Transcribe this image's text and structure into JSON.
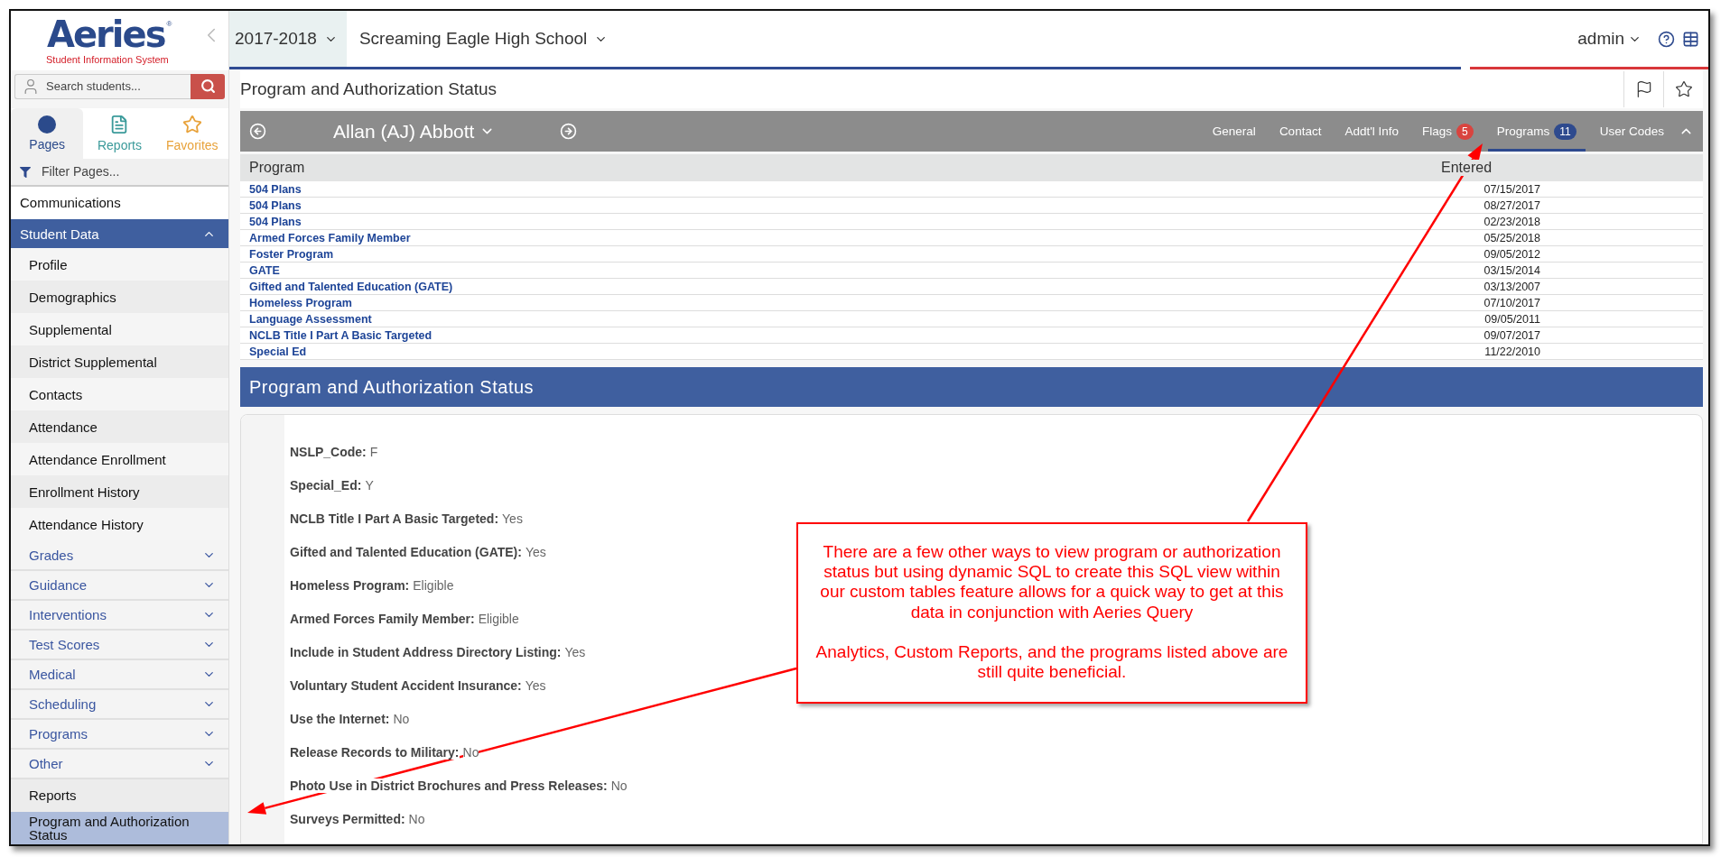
{
  "logo": {
    "name": "Aeries",
    "mark": "®",
    "tagline": "Student Information System"
  },
  "search": {
    "placeholder": "Search students..."
  },
  "sidebar_tabs": [
    {
      "label": "Pages",
      "kind": "pages",
      "color": "#2b4a8b",
      "selected": true
    },
    {
      "label": "Reports",
      "kind": "reports",
      "color": "#3a9a9a",
      "selected": false
    },
    {
      "label": "Favorites",
      "kind": "favorites",
      "color": "#e8a23a",
      "selected": false
    }
  ],
  "filter": {
    "placeholder": "Filter Pages..."
  },
  "nav": [
    {
      "label": "Communications",
      "kind": "page",
      "selected": false
    },
    {
      "label": "Student Data",
      "kind": "group",
      "expanded": true,
      "children": [
        {
          "label": "Profile",
          "kind": "page",
          "selected": false
        },
        {
          "label": "Demographics",
          "kind": "page",
          "selected": false
        },
        {
          "label": "Supplemental",
          "kind": "page",
          "selected": false
        },
        {
          "label": "District Supplemental",
          "kind": "page",
          "selected": false
        },
        {
          "label": "Contacts",
          "kind": "page",
          "selected": false
        },
        {
          "label": "Attendance",
          "kind": "page",
          "selected": false
        },
        {
          "label": "Attendance Enrollment",
          "kind": "page",
          "selected": false
        },
        {
          "label": "Enrollment History",
          "kind": "page",
          "selected": false
        },
        {
          "label": "Attendance History",
          "kind": "page",
          "selected": false
        },
        {
          "label": "Grades",
          "kind": "group",
          "expanded": false
        },
        {
          "label": "Guidance",
          "kind": "group",
          "expanded": false
        },
        {
          "label": "Interventions",
          "kind": "group",
          "expanded": false
        },
        {
          "label": "Test Scores",
          "kind": "group",
          "expanded": false
        },
        {
          "label": "Medical",
          "kind": "group",
          "expanded": false
        },
        {
          "label": "Scheduling",
          "kind": "group",
          "expanded": false
        },
        {
          "label": "Programs",
          "kind": "group",
          "expanded": false
        },
        {
          "label": "Other",
          "kind": "group",
          "expanded": false
        },
        {
          "label": "Reports",
          "kind": "page",
          "selected": false
        },
        {
          "label": "Program and Authorization Status",
          "kind": "page",
          "selected": true
        }
      ]
    }
  ],
  "top_bar": {
    "year": "2017-2018",
    "school": "Screaming Eagle High School",
    "user": "admin"
  },
  "page_title": "Program and Authorization Status",
  "student": {
    "name": "Allan (AJ) Abbott",
    "tabs_expanded": true,
    "tabs": [
      {
        "label": "General",
        "selected": false
      },
      {
        "label": "Contact",
        "selected": false
      },
      {
        "label": "Addt'l Info",
        "selected": false
      },
      {
        "label": "Flags",
        "badge": "5",
        "color": "#d9443f",
        "selected": false
      },
      {
        "label": "Programs",
        "badge": "11",
        "color": "#2e4a8e",
        "selected": true
      },
      {
        "label": "User Codes",
        "selected": false
      }
    ]
  },
  "table": {
    "columns": [
      "Program",
      "Entered"
    ],
    "rows": [
      [
        "504 Plans",
        "07/15/2017"
      ],
      [
        "504 Plans",
        "08/27/2017"
      ],
      [
        "504 Plans",
        "02/23/2018"
      ],
      [
        "Armed Forces Family Member",
        "05/25/2018"
      ],
      [
        "Foster Program",
        "09/05/2012"
      ],
      [
        "GATE",
        "03/15/2014"
      ],
      [
        "Gifted and Talented Education (GATE)",
        "03/13/2007"
      ],
      [
        "Homeless Program",
        "07/10/2017"
      ],
      [
        "Language Assessment",
        "09/05/2011"
      ],
      [
        "NCLB Title I Part A Basic Targeted",
        "09/07/2017"
      ],
      [
        "Special Ed",
        "11/22/2010"
      ]
    ]
  },
  "section": {
    "title": "Program and Authorization Status",
    "fields": [
      {
        "label": "NSLP_Code:",
        "value": "F"
      },
      {
        "label": "Special_Ed:",
        "value": "Y"
      },
      {
        "label": "NCLB Title I Part A Basic Targeted:",
        "value": "Yes"
      },
      {
        "label": "Gifted and Talented Education (GATE):",
        "value": "Yes"
      },
      {
        "label": "Homeless Program:",
        "value": "Eligible"
      },
      {
        "label": "Armed Forces Family Member:",
        "value": "Eligible"
      },
      {
        "label": "Include in Student Address Directory Listing:",
        "value": "Yes"
      },
      {
        "label": "Voluntary Student Accident Insurance:",
        "value": "Yes"
      },
      {
        "label": "Use the Internet:",
        "value": "No"
      },
      {
        "label": "Release Records to Military:",
        "value": "No"
      },
      {
        "label": "Photo Use in District Brochures and Press Releases:",
        "value": "No"
      },
      {
        "label": "Surveys Permitted:",
        "value": "No"
      }
    ]
  },
  "callout": {
    "paragraphs": [
      "There are a few other ways to view program or authorization status but using dynamic SQL to create this SQL view within our custom tables feature allows for a quick way to get at this data in conjunction with Aeries Query",
      "Analytics, Custom Reports, and the programs listed above are still quite beneficial."
    ]
  }
}
